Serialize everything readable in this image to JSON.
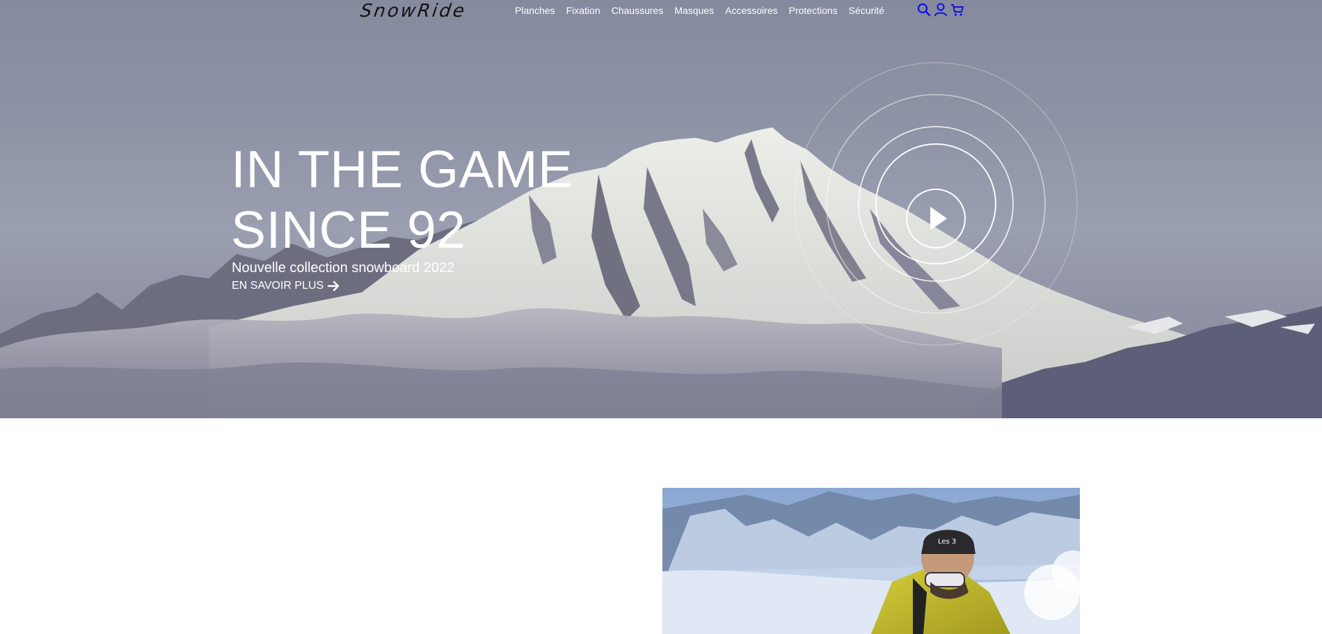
{
  "brand": {
    "logo": "SnowRide"
  },
  "nav": {
    "items": [
      {
        "label": "Planches"
      },
      {
        "label": "Fixation"
      },
      {
        "label": "Chaussures"
      },
      {
        "label": "Masques"
      },
      {
        "label": "Accessoires"
      },
      {
        "label": "Protections"
      },
      {
        "label": "Sécurité"
      }
    ],
    "icons": [
      "search-icon",
      "user-icon",
      "cart-icon"
    ],
    "icon_color": "#1010e0"
  },
  "hero": {
    "title_line1": "IN THE GAME",
    "title_line2": "SINCE 92",
    "subtitle": "Nouvelle collection snowboard 2022",
    "cta": "EN SAVOIR PLUS",
    "cta_icon": "arrow-right-icon",
    "play_icon": "play-icon"
  },
  "colors": {
    "hero_text": "#ffffff",
    "logo": "#121212",
    "page_background": "#ffffff"
  }
}
